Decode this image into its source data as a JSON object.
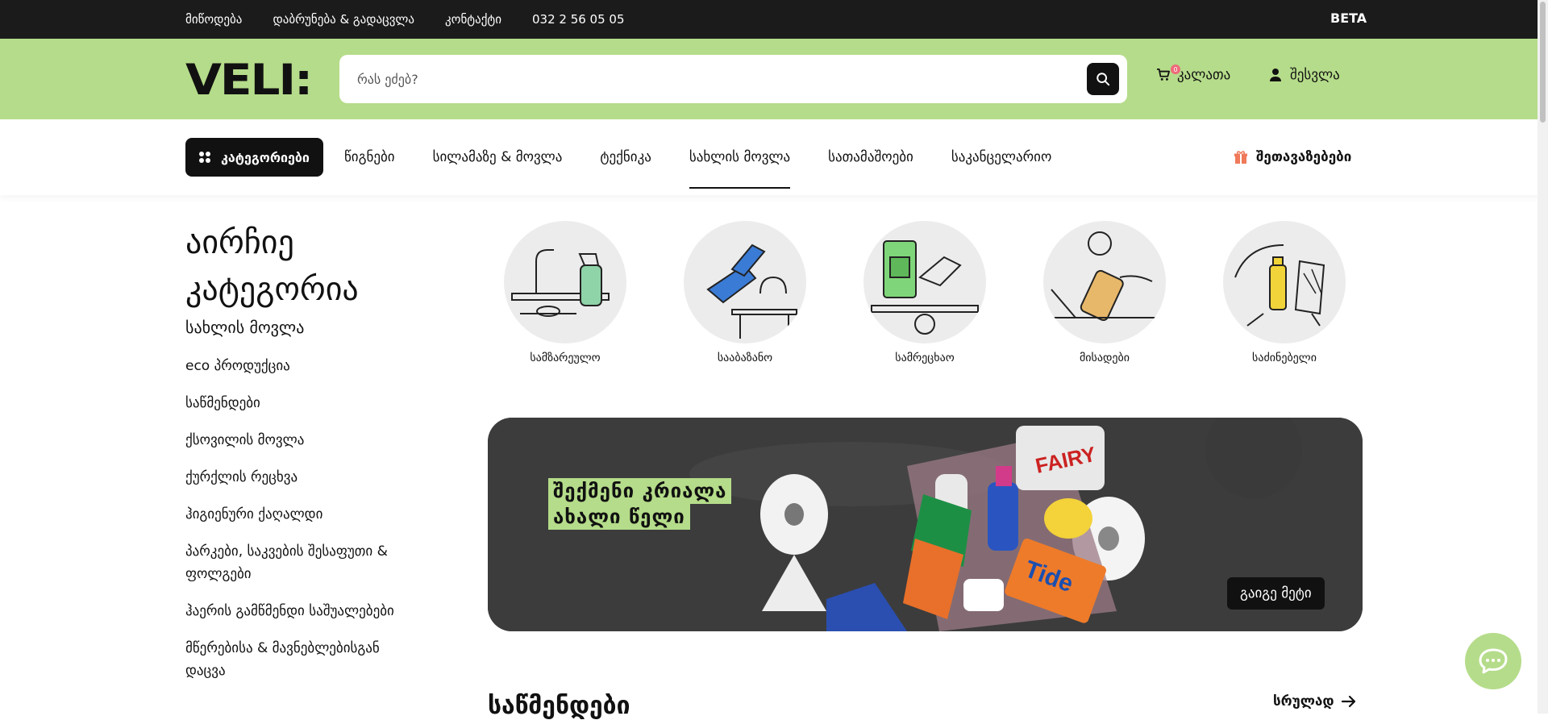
{
  "topbar": {
    "links": [
      "მიწოდება",
      "დაბრუნება & გადაცვლა",
      "კონტაქტი",
      "032 2 56 05 05"
    ],
    "beta": "BETA"
  },
  "header": {
    "logo": "VELI:",
    "search_placeholder": "რას ეძებ?",
    "cart_label": "კალათა",
    "cart_count": "0",
    "login_label": "შესვლა"
  },
  "nav": {
    "categories_label": "კატეგორიები",
    "links": [
      "წიგნები",
      "სილამაზე & მოვლა",
      "ტექნიკა",
      "სახლის მოვლა",
      "სათამაშოები",
      "საკანცელარიო"
    ],
    "active": "სახლის მოვლა",
    "offers_label": "შეთავაზებები"
  },
  "sidebar": {
    "title": "აირჩიე კატეგორია",
    "heading": "სახლის მოვლა",
    "items": [
      "eco პროდუქცია",
      "საწმენდები",
      "ქსოვილის მოვლა",
      "ქურქლის რეცხვა",
      "ჰიგიენური ქაღალდი",
      "პარკები, საკვების შესაფუთი & ფოლგები",
      "ჰაერის გამწმენდი საშუალებები",
      "მწერებისა & მავნებლებისგან დაცვა"
    ]
  },
  "categories": [
    {
      "label": "სამზარეულო",
      "icon": "kitchen-spray-icon",
      "accent": "#8fd3a8"
    },
    {
      "label": "სააბაზანო",
      "icon": "bathroom-bottle-icon",
      "accent": "#3a7bd5"
    },
    {
      "label": "სამრეცხაო",
      "icon": "laundry-detergent-icon",
      "accent": "#7fd67a"
    },
    {
      "label": "მისადები",
      "icon": "floor-mop-icon",
      "accent": "#e8b86a"
    },
    {
      "label": "საძინებელი",
      "icon": "bedroom-spray-icon",
      "accent": "#f0d43a"
    }
  ],
  "banner": {
    "line1": "შექმენი კრიალა",
    "line2": "ახალი წელი",
    "button": "გაიგე მეტი"
  },
  "section": {
    "title": "საწმენდები",
    "see_all": "სრულად"
  },
  "colors": {
    "brand_green": "#b5dc8a",
    "dark": "#1b1b1b",
    "badge": "#ef6a7a",
    "gift": "#f07a5a"
  }
}
